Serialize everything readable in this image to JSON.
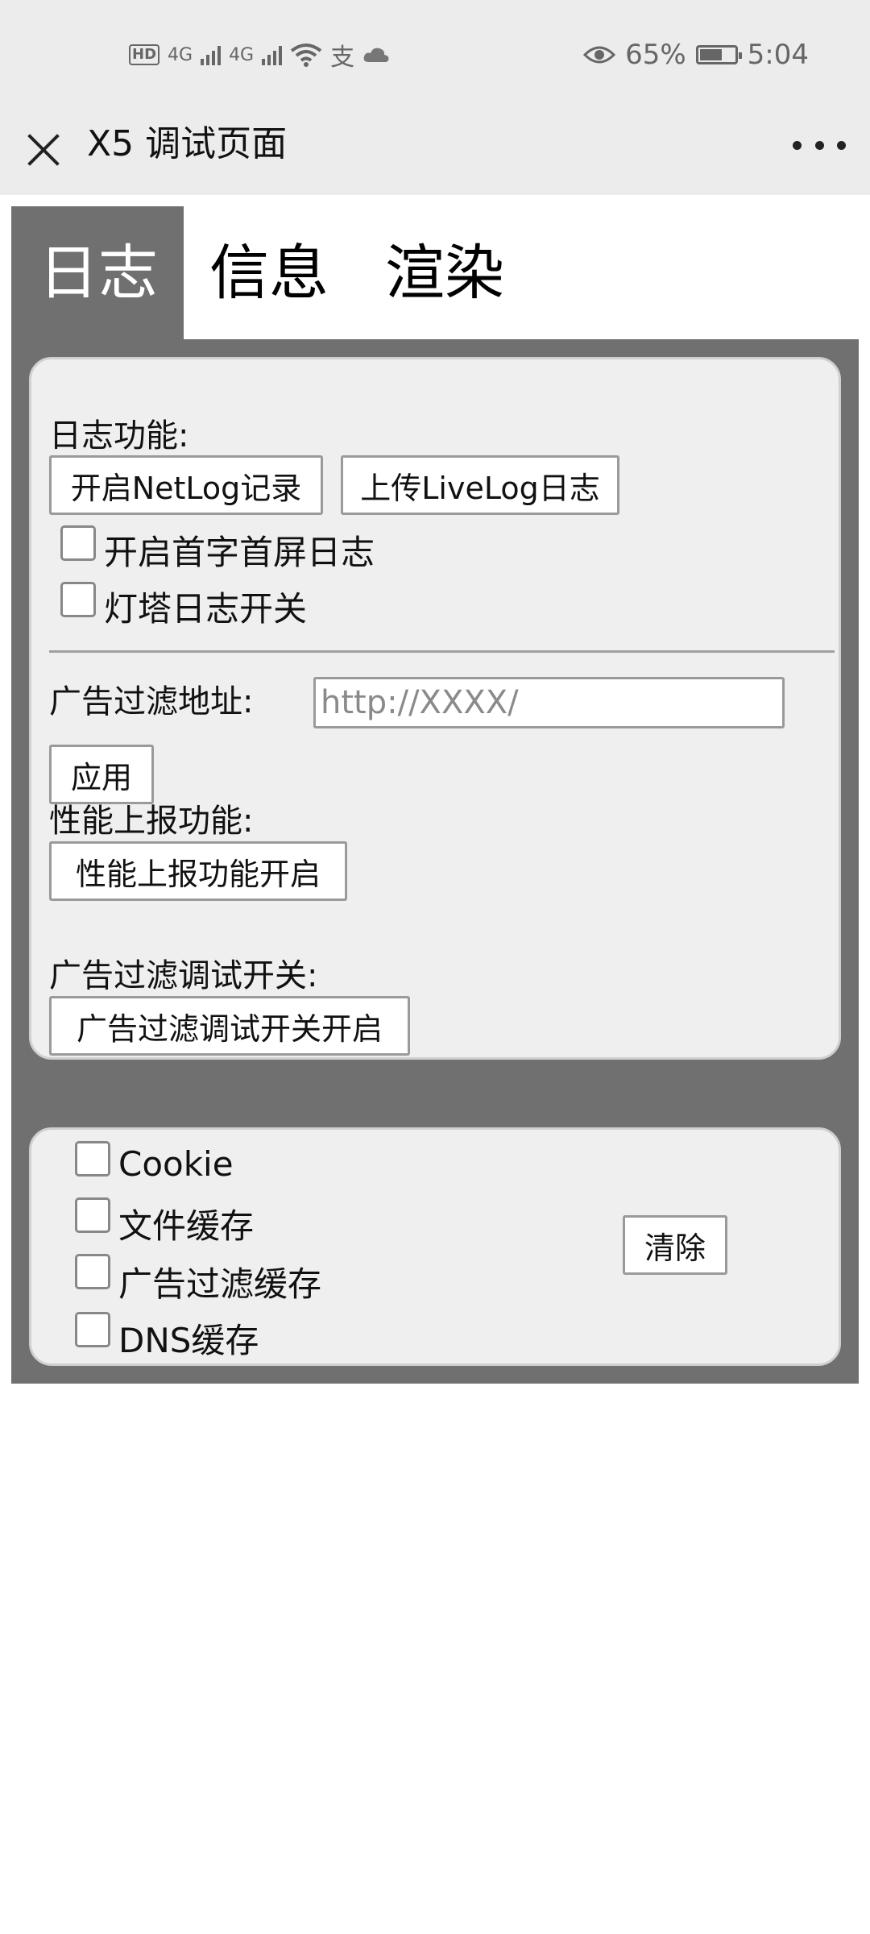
{
  "status_bar": {
    "hd": "HD",
    "signal1": "4G",
    "signal2": "4G",
    "battery_percent": "65%",
    "battery_level": 0.65,
    "time": "5:04"
  },
  "titlebar": {
    "title": "X5 调试页面"
  },
  "tabs": [
    {
      "label": "日志",
      "active": true
    },
    {
      "label": "信息",
      "active": false
    },
    {
      "label": "渲染",
      "active": false
    }
  ],
  "log_section": {
    "title": "日志功能:",
    "netlog_button": "开启NetLog记录",
    "livelog_button": "上传LiveLog日志",
    "checkbox_first_screen": "开启首字首屏日志",
    "checkbox_lighthouse": "灯塔日志开关"
  },
  "ad_filter": {
    "label": "广告过滤地址:",
    "placeholder": "http://XXXX/",
    "value": "",
    "apply_button": "应用"
  },
  "perf": {
    "label": "性能上报功能:",
    "button": "性能上报功能开启"
  },
  "ad_debug": {
    "label": "广告过滤调试开关:",
    "button": "广告过滤调试开关开启"
  },
  "clear_section": {
    "items": [
      "Cookie",
      "文件缓存",
      "广告过滤缓存",
      "DNS缓存"
    ],
    "clear_button": "清除"
  },
  "colors": {
    "chrome_bg": "#ececec",
    "panel_bg": "#707070",
    "card_bg": "#efefef"
  }
}
